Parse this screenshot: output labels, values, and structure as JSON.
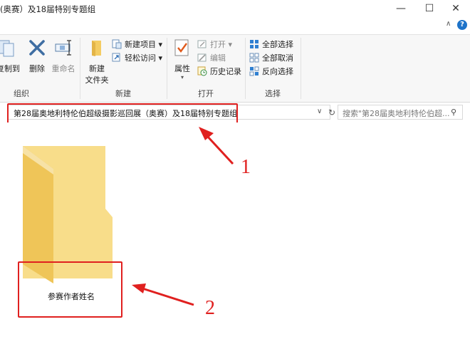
{
  "window": {
    "title": "(奥赛）及18届特别专题组",
    "minimize_glyph": "—",
    "maximize_glyph": "☐",
    "close_glyph": "✕"
  },
  "ribbon_top": {
    "collapse_glyph": "∧",
    "help_glyph": "?"
  },
  "ribbon": {
    "organize": {
      "label": "组织",
      "copy_label": "复制到",
      "delete_label": "删除",
      "rename_label": "重命名"
    },
    "new": {
      "label": "新建",
      "new_folder_line1": "新建",
      "new_folder_line2": "文件夹",
      "new_item_label": "新建项目 ▾",
      "easy_access_label": "轻松访问 ▾"
    },
    "open": {
      "label": "打开",
      "properties_label": "属性",
      "open_label": "打开 ▾",
      "edit_label": "编辑",
      "history_label": "历史记录"
    },
    "select": {
      "label": "选择",
      "select_all_label": "全部选择",
      "select_none_label": "全部取消",
      "invert_label": "反向选择"
    }
  },
  "address": {
    "path": "第28届奥地利特伦伯超级摄影巡回展（奥赛）及18届特别专题组",
    "dropdown_glyph": "∨",
    "refresh_glyph": "↻"
  },
  "search": {
    "placeholder": "搜索\"第28届奥地利特伦伯超...",
    "icon_glyph": "⚲"
  },
  "folder": {
    "name": "参赛作者姓名"
  },
  "annotations": {
    "one": "1",
    "two": "2",
    "color": "#e0201f"
  },
  "colors": {
    "folder_light": "#ffe8a3",
    "folder_dark": "#f2c55c",
    "accent_blue": "#1e73c9"
  }
}
